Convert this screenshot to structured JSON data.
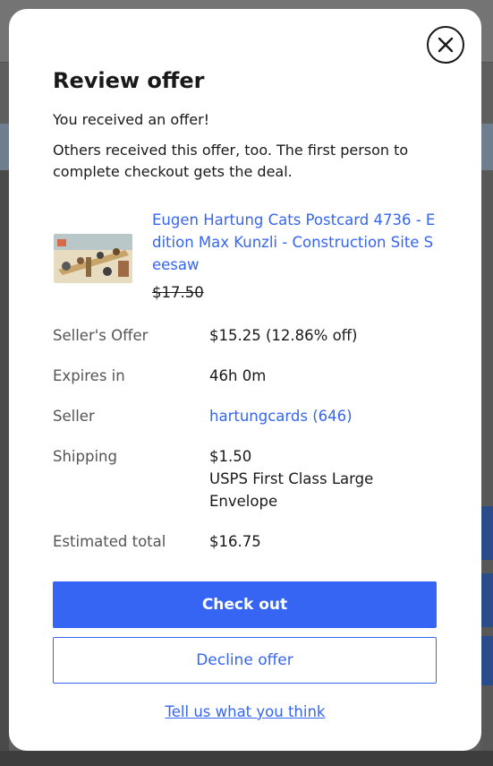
{
  "modal": {
    "title": "Review offer",
    "subtitle": "You received an offer!",
    "notice": "Others received this offer, too. The first person to complete checkout gets the deal.",
    "close_icon": "close-icon"
  },
  "item": {
    "title": "Eugen Hartung Cats Postcard 4736 - Edition Max Kunzli - Construction Site Seesaw",
    "original_price": "$17.50",
    "thumbnail_icon": "postcard-thumbnail"
  },
  "details": [
    {
      "label": "Seller's Offer",
      "value": "$15.25 (12.86% off)"
    },
    {
      "label": "Expires in",
      "value": "46h 0m"
    },
    {
      "label": "Seller",
      "value": "hartungcards (646)"
    },
    {
      "label": "Shipping",
      "value": "$1.50",
      "value_extra": "USPS First Class Large Envelope"
    },
    {
      "label": "Estimated total",
      "value": "$16.75"
    }
  ],
  "actions": {
    "checkout_label": "Check out",
    "decline_label": "Decline offer",
    "feedback_label": "Tell us what you think"
  },
  "colors": {
    "accent": "#3665f3",
    "text": "#191919",
    "muted": "#555555"
  }
}
